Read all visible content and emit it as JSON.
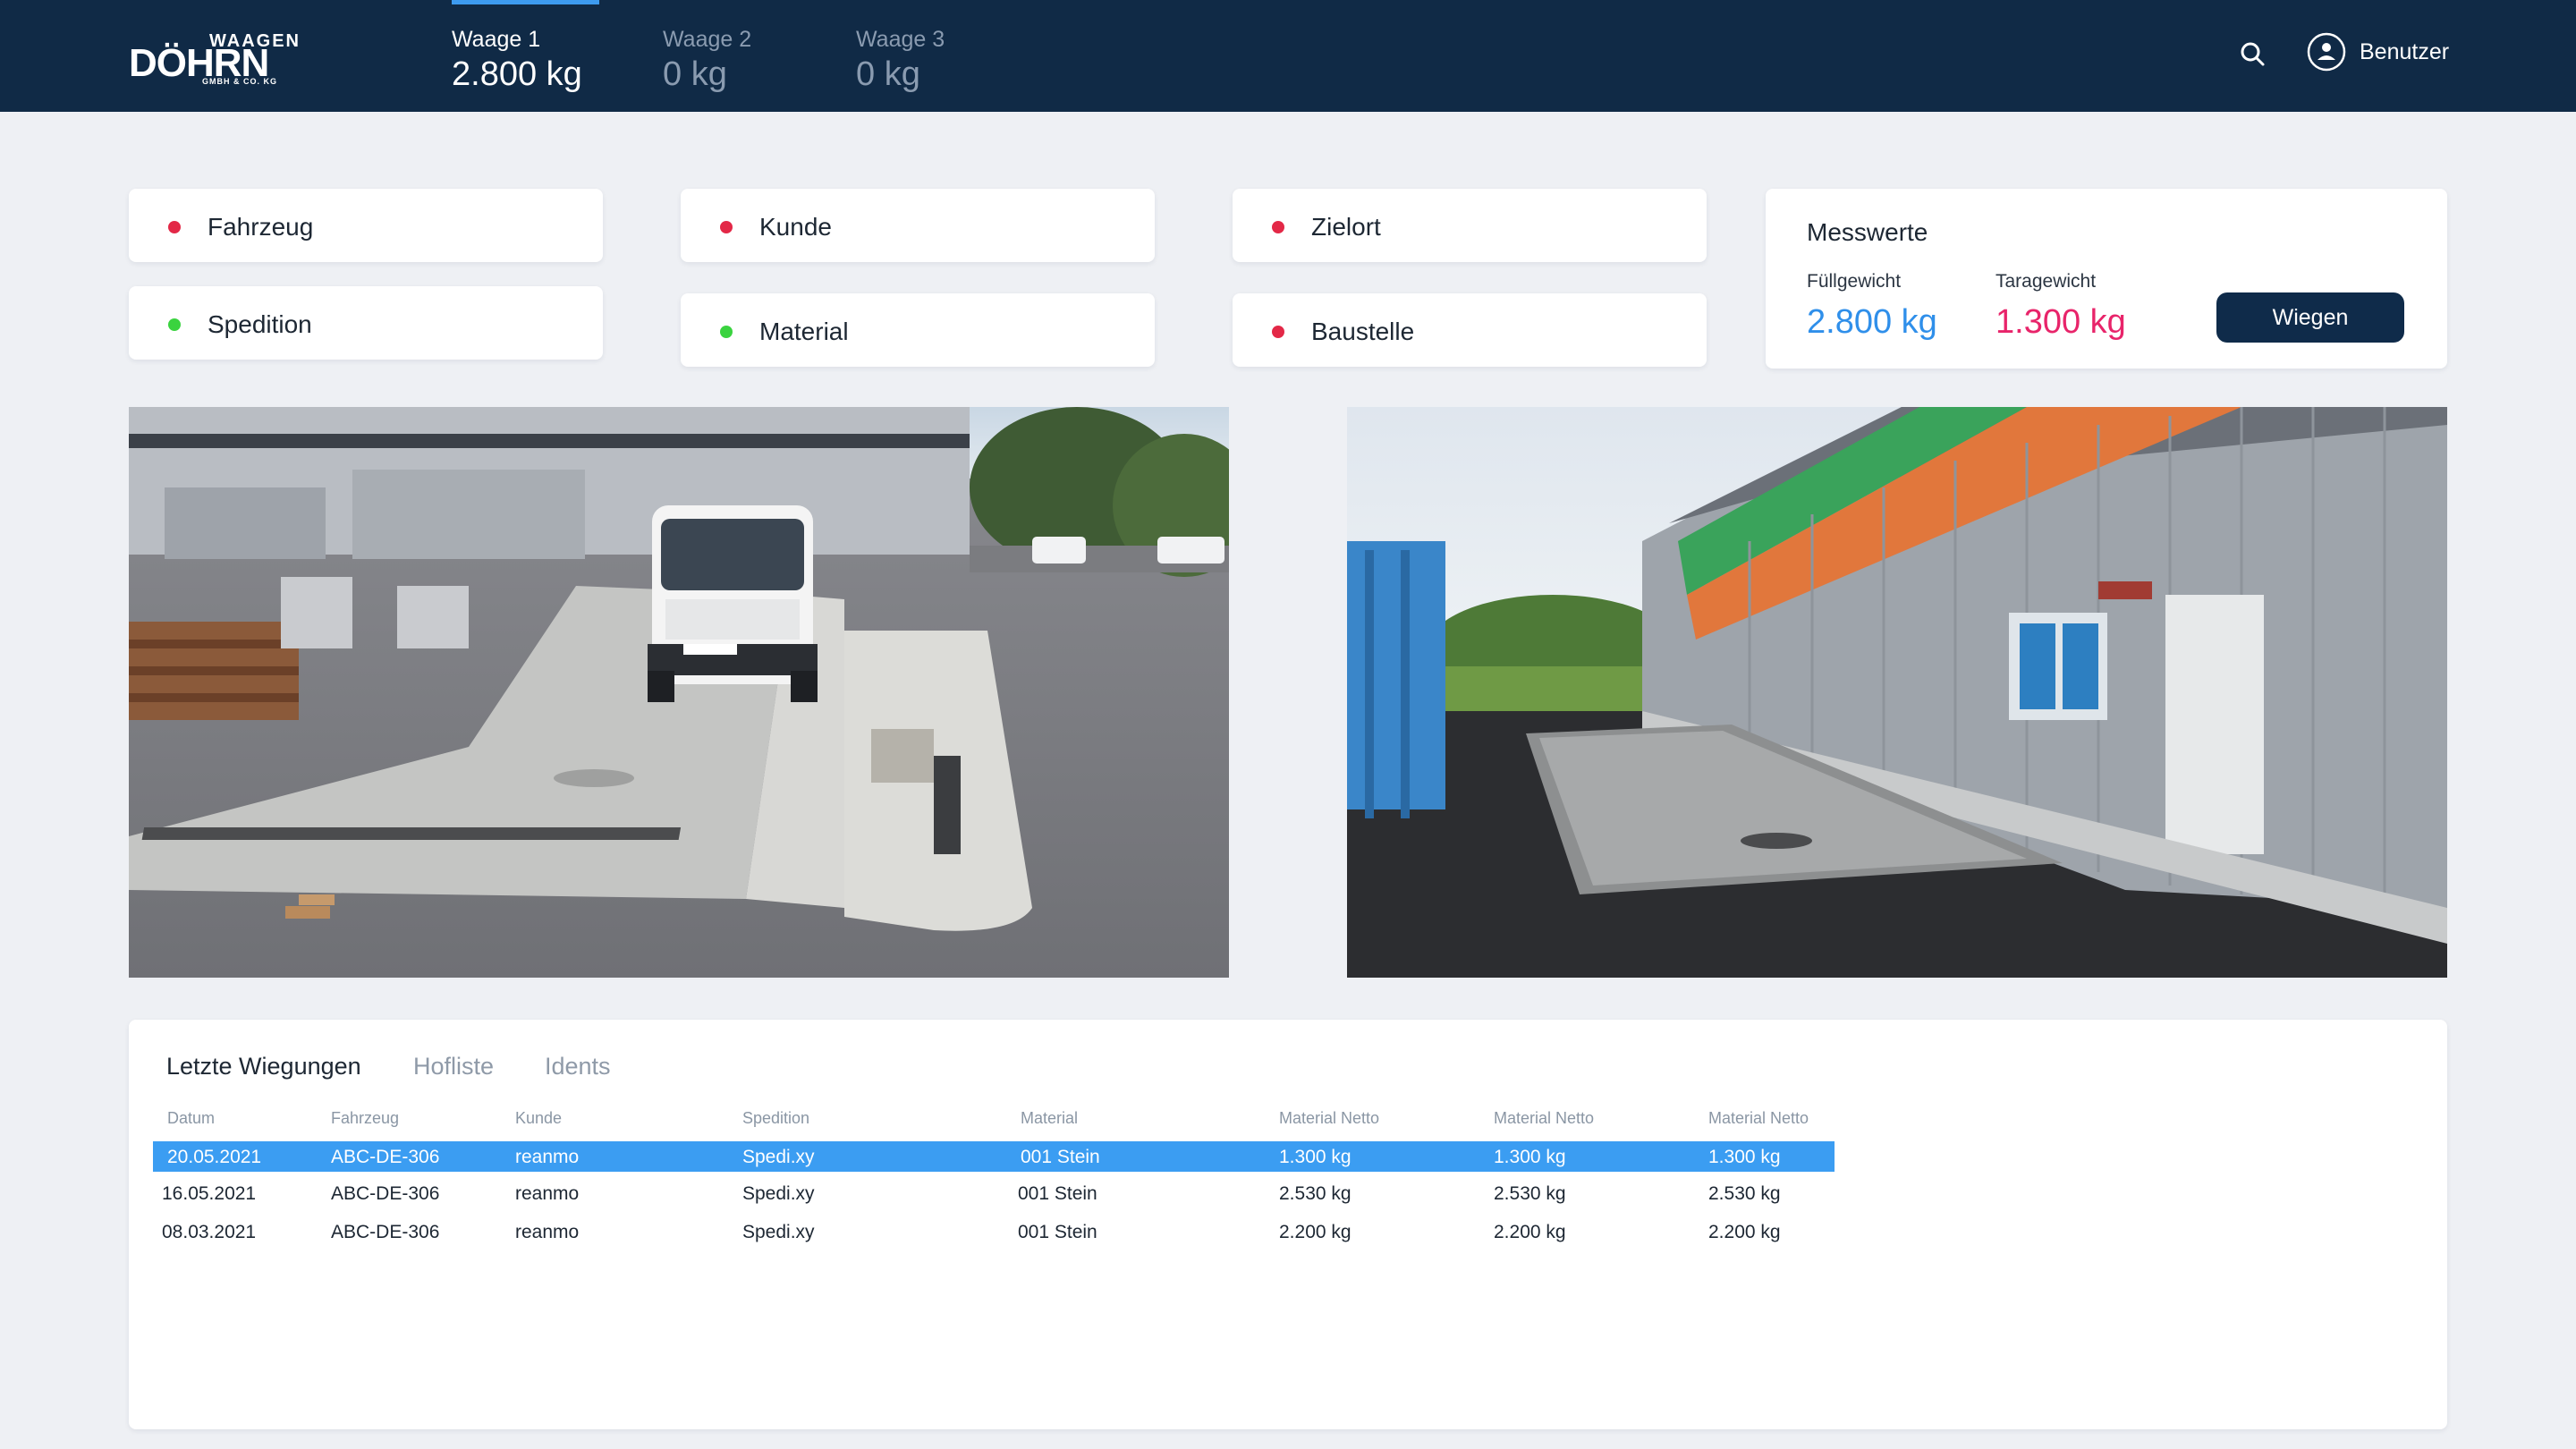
{
  "header": {
    "logo": {
      "top": "WAAGEN",
      "main": "DÖHRN",
      "sub": "GMBH & CO. KG"
    },
    "scales": [
      {
        "name": "Waage 1",
        "weight": "2.800 kg",
        "active": true
      },
      {
        "name": "Waage 2",
        "weight": "0 kg",
        "active": false
      },
      {
        "name": "Waage 3",
        "weight": "0 kg",
        "active": false
      }
    ],
    "search_icon": "search-icon",
    "user_icon": "user-circle-icon",
    "user_label": "Benutzer"
  },
  "fields": [
    {
      "label": "Fahrzeug",
      "status": "red"
    },
    {
      "label": "Kunde",
      "status": "red"
    },
    {
      "label": "Zielort",
      "status": "red"
    },
    {
      "label": "Spedition",
      "status": "green"
    },
    {
      "label": "Material",
      "status": "green"
    },
    {
      "label": "Baustelle",
      "status": "red"
    }
  ],
  "messwerte": {
    "title": "Messwerte",
    "fuell_label": "Füllgewicht",
    "fuell_value": "2.800 kg",
    "tara_label": "Taragewicht",
    "tara_value": "1.300 kg",
    "button": "Wiegen"
  },
  "colors": {
    "header": "#102a46",
    "accent": "#3b9df2",
    "status_red": "#e32847",
    "status_green": "#3ad33f",
    "fuell": "#2f8fea",
    "tara": "#e8246a"
  },
  "table": {
    "tabs": [
      "Letzte Wiegungen",
      "Hofliste",
      "Idents"
    ],
    "columns": [
      "Datum",
      "Fahrzeug",
      "Kunde",
      "Spedition",
      "Material",
      "Material Netto",
      "Material Netto",
      "Material Netto"
    ],
    "rows": [
      [
        "20.05.2021",
        "ABC-DE-306",
        "reanmo",
        "Spedi.xy",
        "001 Stein",
        "1.300 kg",
        "1.300 kg",
        "1.300 kg"
      ],
      [
        "16.05.2021",
        "ABC-DE-306",
        "reanmo",
        "Spedi.xy",
        "001 Stein",
        "2.530 kg",
        "2.530 kg",
        "2.530 kg"
      ],
      [
        "08.03.2021",
        "ABC-DE-306",
        "reanmo",
        "Spedi.xy",
        "001 Stein",
        "2.200 kg",
        "2.200 kg",
        "2.200 kg"
      ]
    ]
  }
}
